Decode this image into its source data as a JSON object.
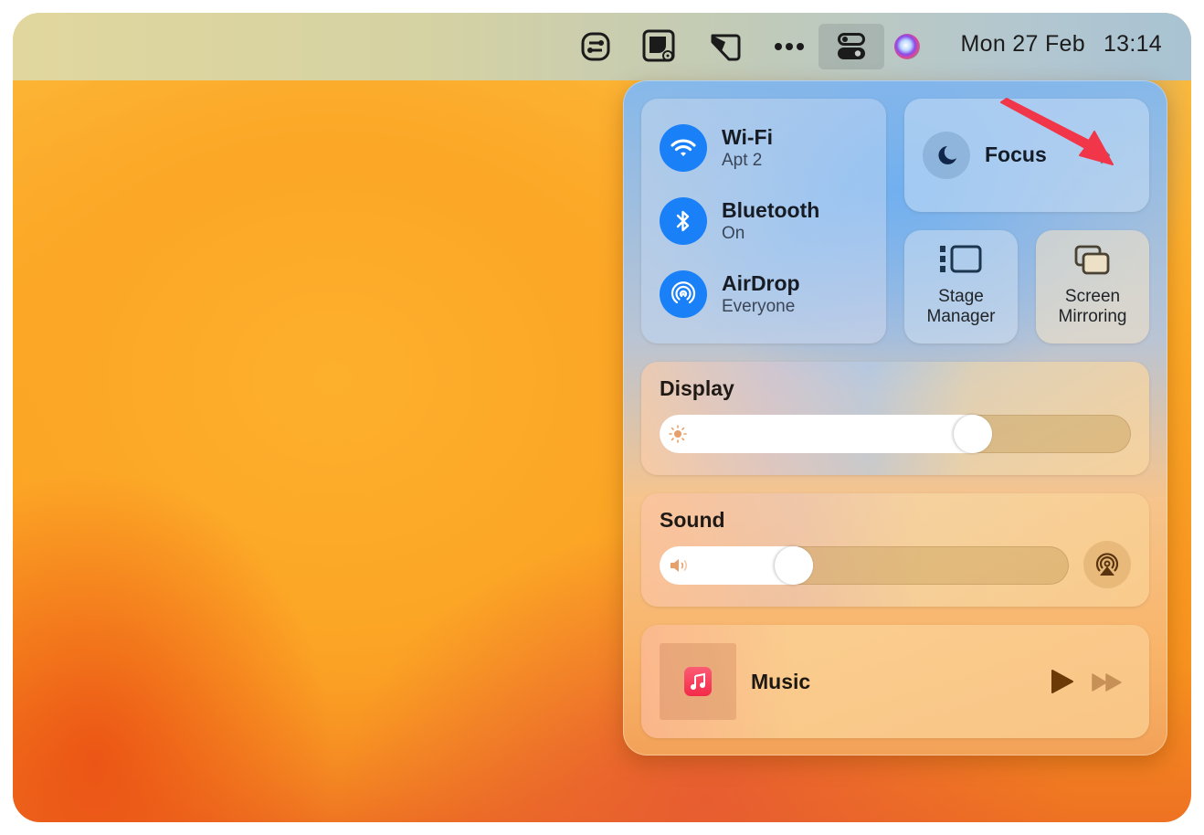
{
  "menubar": {
    "icons": [
      "shortcuts-toggle-icon",
      "screenshot-capture-icon",
      "tag-label-icon",
      "more-ellipsis-icon",
      "control-center-icon",
      "siri-icon"
    ],
    "date": "Mon 27 Feb",
    "time": "13:14"
  },
  "control_center": {
    "connectivity": [
      {
        "icon": "wifi-icon",
        "title": "Wi-Fi",
        "subtitle": "Apt 2"
      },
      {
        "icon": "bluetooth-icon",
        "title": "Bluetooth",
        "subtitle": "On"
      },
      {
        "icon": "airdrop-icon",
        "title": "AirDrop",
        "subtitle": "Everyone"
      }
    ],
    "focus": {
      "label": "Focus",
      "icon": "moon-icon"
    },
    "stage_manager": {
      "label_line1": "Stage",
      "label_line2": "Manager"
    },
    "screen_mirroring": {
      "label_line1": "Screen",
      "label_line2": "Mirroring"
    },
    "display": {
      "title": "Display",
      "brightness": 0.68
    },
    "sound": {
      "title": "Sound",
      "volume": 0.31
    },
    "now_playing": {
      "app": "Music"
    }
  },
  "accent": {
    "blue": "#1a80f7",
    "annotation_arrow": "#f2364a",
    "music_app": "#f42a4a"
  }
}
